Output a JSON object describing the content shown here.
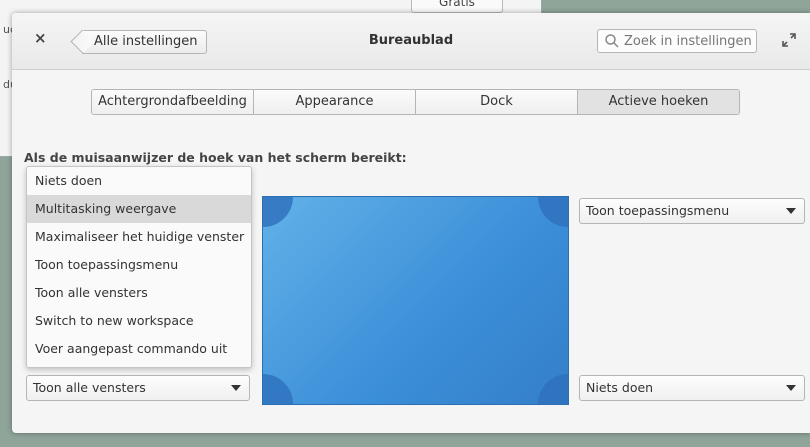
{
  "background": {
    "button_label": "Gratis",
    "fragment_1": "uct",
    "fragment_2": "du"
  },
  "titlebar": {
    "back_label": "Alle instellingen",
    "title": "Bureaublad",
    "search_placeholder": "Zoek in instellingen"
  },
  "tabs": [
    {
      "label": "Achtergrondafbeelding",
      "active": false
    },
    {
      "label": "Appearance",
      "active": false
    },
    {
      "label": "Dock",
      "active": false
    },
    {
      "label": "Actieve hoeken",
      "active": true
    }
  ],
  "heading": "Als de muisaanwijzer de hoek van het scherm bereikt:",
  "dropdown_menu": {
    "items": [
      "Niets doen",
      "Multitasking weergave",
      "Maximaliseer het huidige venster",
      "Toon toepassingsmenu",
      "Toon alle vensters",
      "Switch to new workspace",
      "Voer aangepast commando uit"
    ],
    "highlighted": "Multitasking weergave"
  },
  "corners": {
    "top_right": "Toon toepassingsmenu",
    "bottom_left": "Toon alle vensters",
    "bottom_right": "Niets doen"
  },
  "colors": {
    "desktop_blue": "#4a9fe0",
    "corner_blue": "#2f72bd",
    "outer_background": "#8fa59a"
  }
}
